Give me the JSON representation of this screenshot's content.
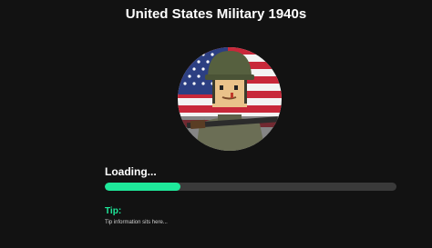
{
  "game": {
    "title": "United States Military 1940s",
    "icon_name": "soldier-flag-icon"
  },
  "loading": {
    "label": "Loading...",
    "progress": 0.26
  },
  "tip": {
    "label": "Tip:",
    "text": "Tip information sits here..."
  },
  "colors": {
    "background": "#121212",
    "accent": "#1ee89a",
    "track": "#3a3a3a",
    "text": "#ffffff"
  }
}
